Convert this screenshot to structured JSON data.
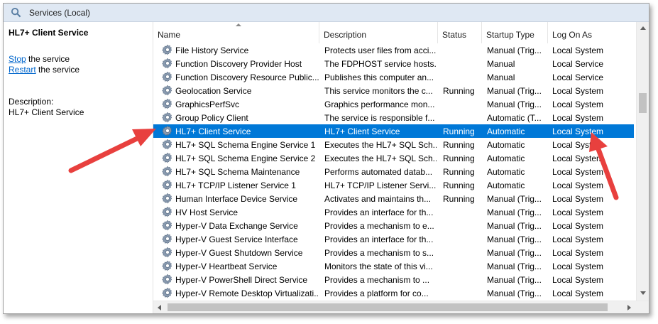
{
  "window": {
    "title": "Services (Local)",
    "icon": "services-icon"
  },
  "left_pane": {
    "service_name": "HL7+ Client Service",
    "stop_link": "Stop",
    "stop_suffix": " the service",
    "restart_link": "Restart",
    "restart_suffix": " the service",
    "description_label": "Description:",
    "description_value": "HL7+ Client Service"
  },
  "columns": {
    "name": "Name",
    "description": "Description",
    "status": "Status",
    "startup": "Startup Type",
    "logon": "Log On As"
  },
  "sorted_column": "name",
  "selected_row": "HL7+ Client Service",
  "services": [
    {
      "name": "File History Service",
      "description": "Protects user files from acci...",
      "status": "",
      "startup": "Manual (Trig...",
      "logon": "Local System"
    },
    {
      "name": "Function Discovery Provider Host",
      "description": "The FDPHOST service hosts...",
      "status": "",
      "startup": "Manual",
      "logon": "Local Service"
    },
    {
      "name": "Function Discovery Resource Public...",
      "description": "Publishes this computer an...",
      "status": "",
      "startup": "Manual",
      "logon": "Local Service"
    },
    {
      "name": "Geolocation Service",
      "description": "This service monitors the c...",
      "status": "Running",
      "startup": "Manual (Trig...",
      "logon": "Local System"
    },
    {
      "name": "GraphicsPerfSvc",
      "description": "Graphics performance mon...",
      "status": "",
      "startup": "Manual (Trig...",
      "logon": "Local System"
    },
    {
      "name": "Group Policy Client",
      "description": "The service is responsible f...",
      "status": "",
      "startup": "Automatic (T...",
      "logon": "Local System"
    },
    {
      "name": "HL7+ Client Service",
      "description": "HL7+ Client Service",
      "status": "Running",
      "startup": "Automatic",
      "logon": "Local System"
    },
    {
      "name": "HL7+ SQL Schema Engine Service 1",
      "description": "Executes the HL7+ SQL Sch...",
      "status": "Running",
      "startup": "Automatic",
      "logon": "Local System"
    },
    {
      "name": "HL7+ SQL Schema Engine Service 2",
      "description": "Executes the HL7+ SQL Sch...",
      "status": "Running",
      "startup": "Automatic",
      "logon": "Local System"
    },
    {
      "name": "HL7+ SQL Schema Maintenance",
      "description": "Performs automated datab...",
      "status": "Running",
      "startup": "Automatic",
      "logon": "Local System"
    },
    {
      "name": "HL7+ TCP/IP Listener Service 1",
      "description": "HL7+ TCP/IP Listener Servi...",
      "status": "Running",
      "startup": "Automatic",
      "logon": "Local System"
    },
    {
      "name": "Human Interface Device Service",
      "description": "Activates and maintains th...",
      "status": "Running",
      "startup": "Manual (Trig...",
      "logon": "Local System"
    },
    {
      "name": "HV Host Service",
      "description": "Provides an interface for th...",
      "status": "",
      "startup": "Manual (Trig...",
      "logon": "Local System"
    },
    {
      "name": "Hyper-V Data Exchange Service",
      "description": "Provides a mechanism to e...",
      "status": "",
      "startup": "Manual (Trig...",
      "logon": "Local System"
    },
    {
      "name": "Hyper-V Guest Service Interface",
      "description": "Provides an interface for th...",
      "status": "",
      "startup": "Manual (Trig...",
      "logon": "Local System"
    },
    {
      "name": "Hyper-V Guest Shutdown Service",
      "description": "Provides a mechanism to s...",
      "status": "",
      "startup": "Manual (Trig...",
      "logon": "Local System"
    },
    {
      "name": "Hyper-V Heartbeat Service",
      "description": "Monitors the state of this vi...",
      "status": "",
      "startup": "Manual (Trig...",
      "logon": "Local System"
    },
    {
      "name": "Hyper-V PowerShell Direct Service",
      "description": "Provides a mechanism to ...",
      "status": "",
      "startup": "Manual (Trig...",
      "logon": "Local System"
    },
    {
      "name": "Hyper-V Remote Desktop Virtualizati...",
      "description": "Provides a platform for co...",
      "status": "",
      "startup": "Manual (Trig...",
      "logon": "Local System"
    }
  ],
  "colors": {
    "selection": "#0078d7",
    "link": "#0066cc",
    "callout_arrow": "#e8403e",
    "titlebar": "#dfe8f3"
  },
  "annotations": [
    {
      "type": "callout-arrow",
      "points_to": "service-icon of selected row"
    },
    {
      "type": "callout-arrow",
      "points_to": "log-on-as of selected row"
    }
  ]
}
